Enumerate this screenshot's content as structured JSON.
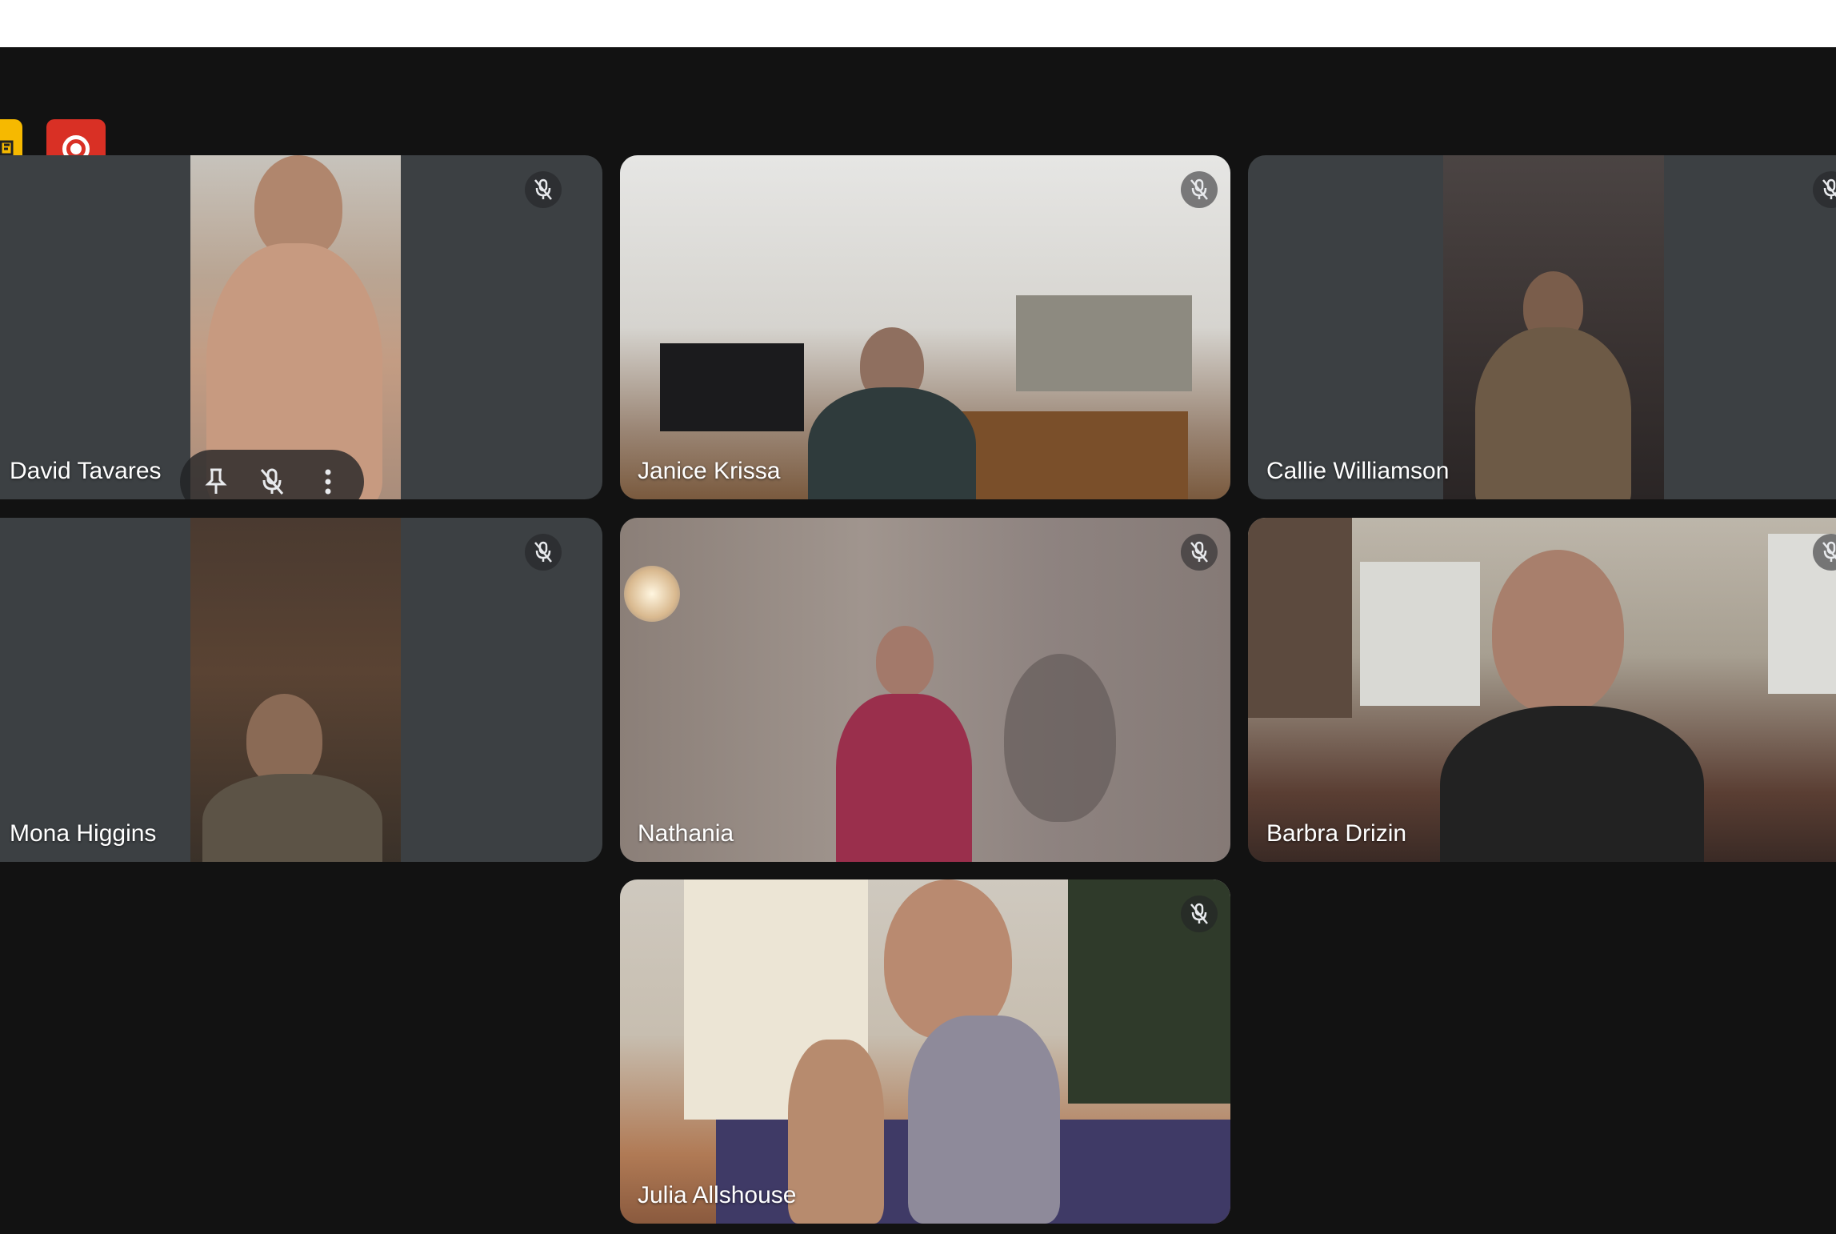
{
  "meeting": {
    "participants": [
      {
        "name": "David Tavares",
        "mic": "muted"
      },
      {
        "name": "Janice Krissa",
        "mic": "muted"
      },
      {
        "name": "Callie Williamson",
        "mic": "muted"
      },
      {
        "name": "Mona Higgins",
        "mic": "muted"
      },
      {
        "name": "Nathania",
        "mic": "muted"
      },
      {
        "name": "Barbra Drizin",
        "mic": "muted"
      },
      {
        "name": "Julia Allshouse",
        "mic": "muted"
      }
    ]
  },
  "toolbar": {
    "left_chip_icon": "activities-icon",
    "record_icon": "record-icon"
  },
  "hover_controls": {
    "icons": [
      "pin-icon",
      "mic-off-icon",
      "more-vert-icon"
    ]
  },
  "colors": {
    "background": "#121212",
    "tile": "#3c4043",
    "record": "#d93025",
    "accent_yellow": "#f6b900"
  }
}
